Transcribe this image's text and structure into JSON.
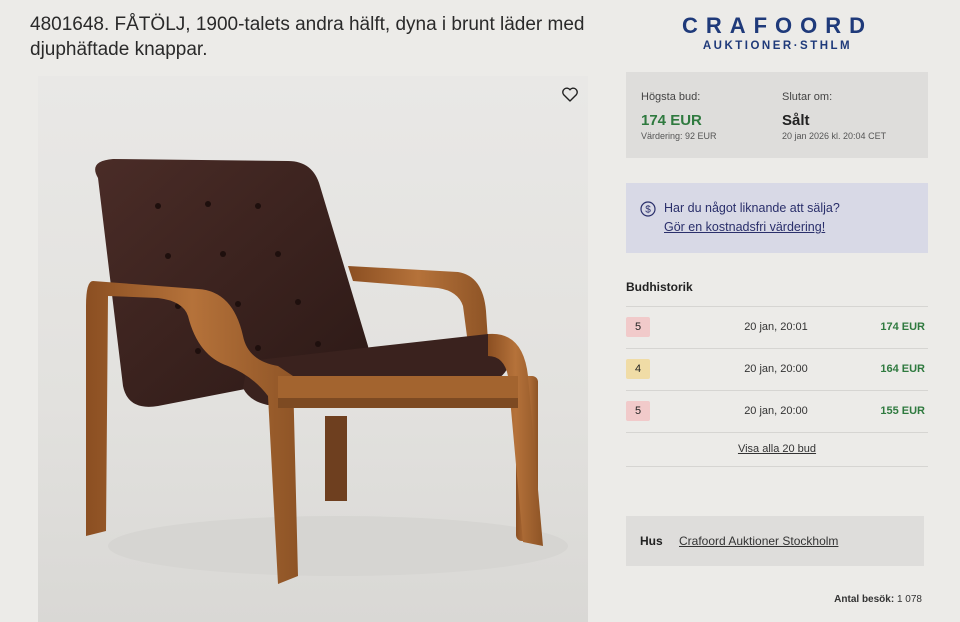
{
  "lot": {
    "title": "4801648. FÅTÖLJ, 1900-talets andra hälft, dyna i brunt läder med djuphäftade knappar."
  },
  "logo": {
    "line1": "CRAFOORD",
    "line2": "AUKTIONER·STHLM"
  },
  "icons": {
    "favorite": "heart-icon",
    "sell": "currency-circle-icon"
  },
  "bid": {
    "highest_label": "Högsta bud:",
    "highest_value": "174 EUR",
    "estimate": "Värdering: 92 EUR",
    "ends_label": "Slutar om:",
    "ends_value": "Sålt",
    "ends_date": "20 jan 2026 kl. 20:04 CET"
  },
  "sell": {
    "question": "Har du något liknande att sälja?",
    "link": "Gör en kostnadsfri värdering!"
  },
  "history": {
    "title": "Budhistorik",
    "rows": [
      {
        "bidder": "5",
        "time": "20 jan, 20:01",
        "amount": "174 EUR",
        "color": "#f1caca"
      },
      {
        "bidder": "4",
        "time": "20 jan, 20:00",
        "amount": "164 EUR",
        "color": "#f0dca6"
      },
      {
        "bidder": "5",
        "time": "20 jan, 20:00",
        "amount": "155 EUR",
        "color": "#f1caca"
      }
    ],
    "show_all": "Visa alla 20 bud"
  },
  "house": {
    "label": "Hus",
    "name": "Crafoord Auktioner Stockholm"
  },
  "visits": {
    "label": "Antal besök:",
    "value": "1 078"
  },
  "colors": {
    "accent_green": "#2f7a3f",
    "logo_blue": "#1f3a7a",
    "sell_box": "#d8d9e6"
  }
}
